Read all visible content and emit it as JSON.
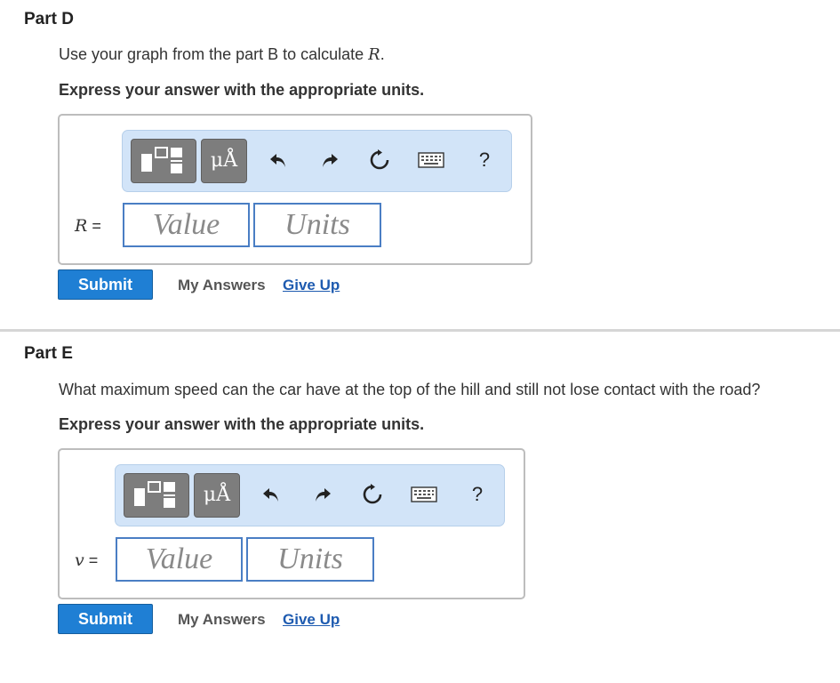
{
  "partD": {
    "title": "Part D",
    "prompt_text": "Use your graph from the part B to calculate ",
    "prompt_var": "R",
    "prompt_end": ".",
    "instruction": "Express your answer with the appropriate units.",
    "var_label": "R",
    "var_eq": " =",
    "value_placeholder": "Value",
    "units_placeholder": "Units",
    "toolbar": {
      "mu_label": "μÅ",
      "help": "?"
    },
    "submit": "Submit",
    "my_answers": "My Answers",
    "give_up": "Give Up"
  },
  "partE": {
    "title": "Part E",
    "prompt_text": "What maximum speed can the car have at the top of the hill and still not lose contact with the road?",
    "instruction": "Express your answer with the appropriate units.",
    "var_label": "v",
    "var_eq": " =",
    "value_placeholder": "Value",
    "units_placeholder": "Units",
    "toolbar": {
      "mu_label": "μÅ",
      "help": "?"
    },
    "submit": "Submit",
    "my_answers": "My Answers",
    "give_up": "Give Up"
  },
  "icons": [
    "templates-icon",
    "units-icon",
    "undo-icon",
    "redo-icon",
    "reset-icon",
    "keyboard-icon",
    "help-icon"
  ],
  "colors": {
    "submit_bg": "#1f7fd4",
    "toolbar_bg": "#d2e4f8",
    "field_border": "#4a7ec4",
    "link": "#1e5bb0"
  }
}
